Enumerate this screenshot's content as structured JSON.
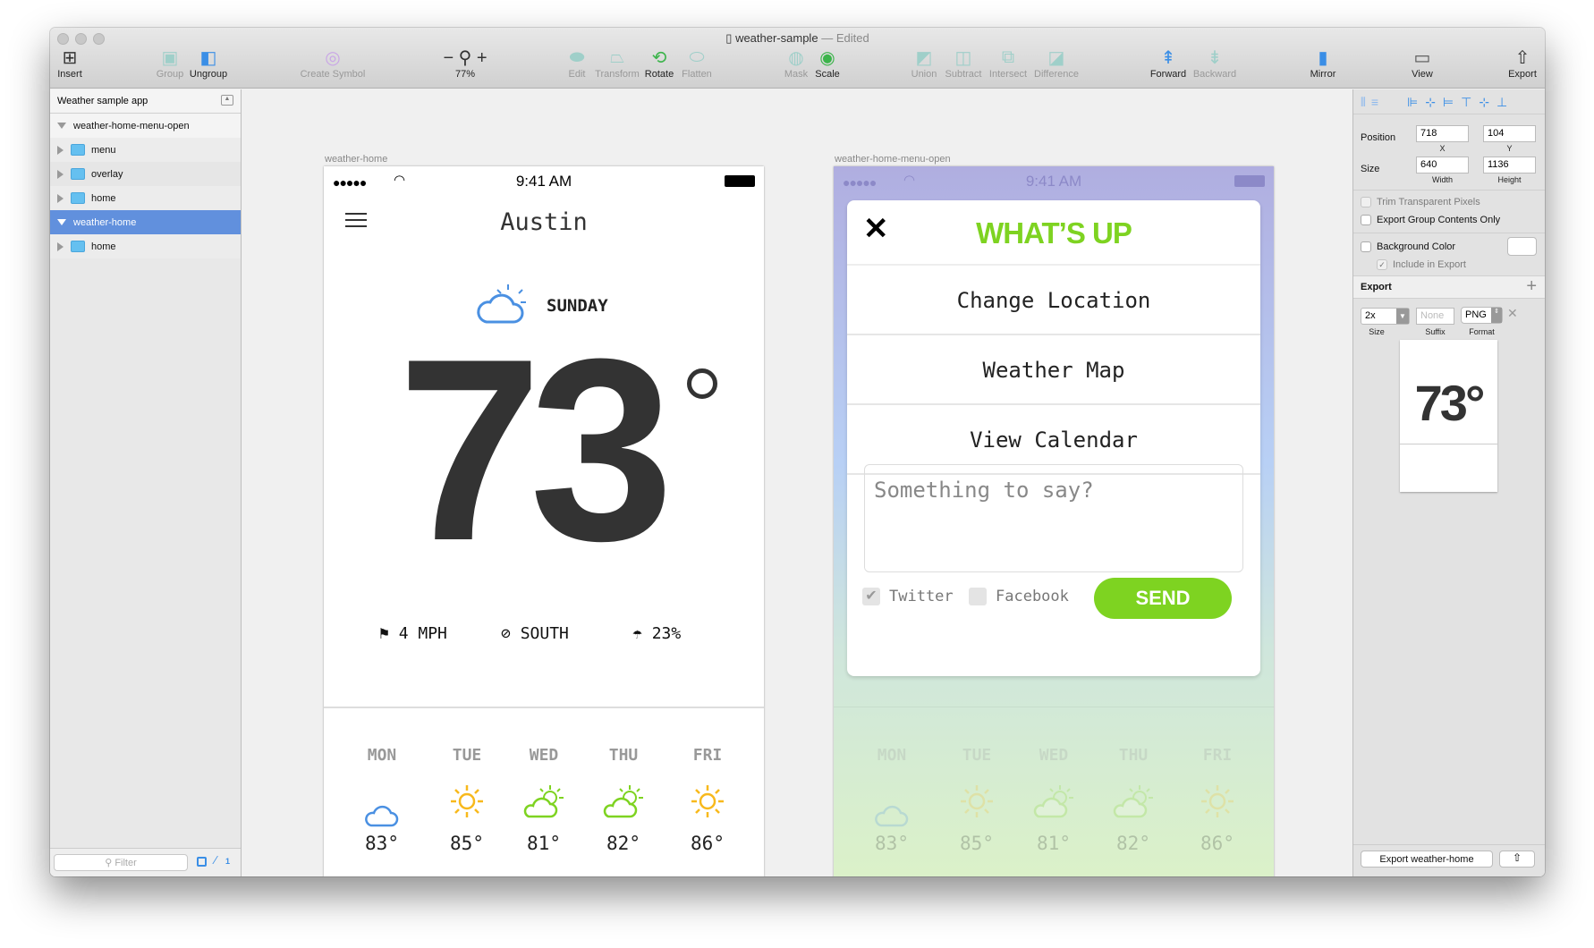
{
  "window": {
    "title": "weather-sample",
    "edited": "Edited"
  },
  "toolbar": [
    {
      "label": "Insert",
      "icon": "plus-icon",
      "enabled": true
    },
    {
      "label": "Group",
      "icon": "group-icon",
      "enabled": false
    },
    {
      "label": "Ungroup",
      "icon": "ungroup-icon",
      "enabled": true
    },
    {
      "label": "Create Symbol",
      "icon": "symbol-icon",
      "enabled": false
    },
    {
      "label": "77%",
      "icon": "zoom-icon",
      "enabled": true
    },
    {
      "label": "Edit",
      "icon": "edit-icon",
      "enabled": false
    },
    {
      "label": "Transform",
      "icon": "transform-icon",
      "enabled": false
    },
    {
      "label": "Rotate",
      "icon": "rotate-icon",
      "enabled": true
    },
    {
      "label": "Flatten",
      "icon": "flatten-icon",
      "enabled": false
    },
    {
      "label": "Mask",
      "icon": "mask-icon",
      "enabled": false
    },
    {
      "label": "Scale",
      "icon": "scale-icon",
      "enabled": true
    },
    {
      "label": "Union",
      "icon": "union-icon",
      "enabled": false
    },
    {
      "label": "Subtract",
      "icon": "subtract-icon",
      "enabled": false
    },
    {
      "label": "Intersect",
      "icon": "intersect-icon",
      "enabled": false
    },
    {
      "label": "Difference",
      "icon": "difference-icon",
      "enabled": false
    },
    {
      "label": "Forward",
      "icon": "forward-icon",
      "enabled": true
    },
    {
      "label": "Backward",
      "icon": "backward-icon",
      "enabled": false
    },
    {
      "label": "Mirror",
      "icon": "mirror-icon",
      "enabled": true
    },
    {
      "label": "View",
      "icon": "view-icon",
      "enabled": true
    },
    {
      "label": "Export",
      "icon": "export-icon",
      "enabled": true
    }
  ],
  "sidebar": {
    "page": "Weather sample app",
    "layers": [
      {
        "name": "weather-home-menu-open",
        "type": "artboard",
        "expanded": true,
        "selected": false
      },
      {
        "name": "menu",
        "type": "group"
      },
      {
        "name": "overlay",
        "type": "group"
      },
      {
        "name": "home",
        "type": "group"
      },
      {
        "name": "weather-home",
        "type": "artboard",
        "expanded": true,
        "selected": true
      },
      {
        "name": "home",
        "type": "group"
      }
    ],
    "filter_placeholder": "Filter",
    "badge": "1"
  },
  "artboard1": {
    "name": "weather-home",
    "status": {
      "time": "9:41 AM"
    },
    "city": "Austin",
    "day": "SUNDAY",
    "temp": "73",
    "wind": "4 MPH",
    "direction": "SOUTH",
    "rain": "23%",
    "forecast": [
      {
        "day": "MON",
        "temp": "83°",
        "icon": "cloud-icon"
      },
      {
        "day": "TUE",
        "temp": "85°",
        "icon": "sun-icon"
      },
      {
        "day": "WED",
        "temp": "81°",
        "icon": "partly-cloudy-icon"
      },
      {
        "day": "THU",
        "temp": "82°",
        "icon": "partly-cloudy-icon"
      },
      {
        "day": "FRI",
        "temp": "86°",
        "icon": "sun-icon"
      }
    ],
    "page_dots": 5,
    "active_dot": 4
  },
  "artboard2": {
    "name": "weather-home-menu-open",
    "status": {
      "time": "9:41 AM"
    },
    "menu_title": "WHAT’S UP",
    "menu_items": [
      "Change Location",
      "Weather Map",
      "View Calendar"
    ],
    "message_placeholder": "Something to say?",
    "twitter": {
      "label": "Twitter",
      "checked": true
    },
    "facebook": {
      "label": "Facebook",
      "checked": false
    },
    "send": "SEND",
    "forecast": [
      {
        "day": "MON",
        "temp": "83°"
      },
      {
        "day": "TUE",
        "temp": "85°"
      },
      {
        "day": "WED",
        "temp": "81°"
      },
      {
        "day": "THU",
        "temp": "82°"
      },
      {
        "day": "FRI",
        "temp": "86°"
      }
    ]
  },
  "inspector": {
    "position_label": "Position",
    "x": "718",
    "y": "104",
    "x_label": "X",
    "y_label": "Y",
    "size_label": "Size",
    "width": "640",
    "height": "1136",
    "width_label": "Width",
    "height_label": "Height",
    "trim": "Trim Transparent Pixels",
    "group_only": "Export Group Contents Only",
    "bg_color": "Background Color",
    "include": "Include in Export",
    "export_title": "Export",
    "export_size": "2x",
    "suffix_placeholder": "None",
    "format": "PNG",
    "size_cap": "Size",
    "suffix_cap": "Suffix",
    "format_cap": "Format",
    "export_button": "Export weather-home"
  },
  "colors": {
    "accent_green": "#7ed321",
    "selection_blue": "#6190dd",
    "cloud_blue": "#4a90e2",
    "sun_yellow": "#f8b91c"
  }
}
